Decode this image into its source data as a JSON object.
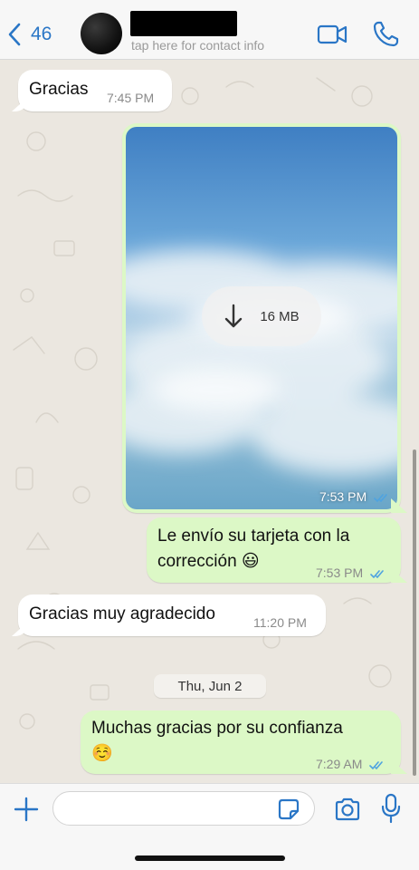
{
  "header": {
    "back_count": "46",
    "contact_subtitle": "tap here for contact info",
    "back_icon": "chevron-left-icon",
    "video_icon": "video-camera-icon",
    "call_icon": "phone-icon"
  },
  "colors": {
    "accent": "#2a76c6",
    "outgoing_bubble": "#dcf8c6",
    "incoming_bubble": "#ffffff",
    "chat_background": "#ebe7e0",
    "read_ticks": "#4fa3e0"
  },
  "messages": [
    {
      "direction": "in",
      "text": "Gracias",
      "time": "7:45 PM"
    },
    {
      "direction": "out",
      "type": "image",
      "download_size": "16 MB",
      "time": "7:53 PM",
      "status": "read"
    },
    {
      "direction": "out",
      "line1": "Le envío su tarjeta con la",
      "line2": "corrección 😃",
      "time": "7:53 PM",
      "status": "read"
    },
    {
      "direction": "in",
      "text": "Gracias muy agradecido",
      "time": "11:20 PM"
    },
    {
      "direction": "out",
      "line1": "Muchas gracias por su confianza",
      "line2": "☺️",
      "time": "7:29 AM",
      "status": "read"
    }
  ],
  "date_divider": "Thu, Jun 2",
  "input_bar": {
    "message_value": "",
    "plus_icon": "plus-icon",
    "sticker_icon": "sticker-icon",
    "camera_icon": "camera-icon",
    "mic_icon": "microphone-icon"
  }
}
